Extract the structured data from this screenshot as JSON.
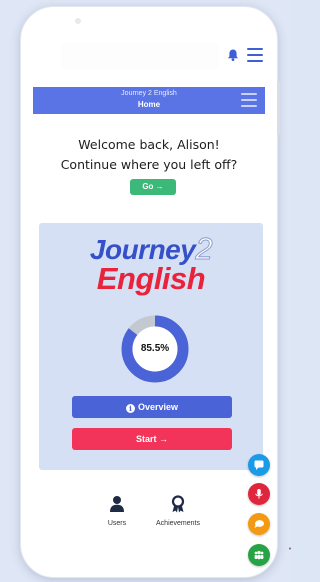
{
  "header": {
    "subtitle": "Journey 2 English",
    "title": "Home"
  },
  "welcome": {
    "line1": "Welcome back, Alison!",
    "line2": "Continue where you left off?",
    "go_label": "Go →"
  },
  "course_card": {
    "logo_part1": "Journey",
    "logo_number": "2",
    "logo_part2": "English",
    "progress_label": "85.5%",
    "progress_value": 0.855,
    "overview_label": "Overview",
    "start_label": "Start →"
  },
  "bottom_nav": {
    "users_label": "Users",
    "achievements_label": "Achievements"
  },
  "fabs": [
    {
      "icon": "chat-bubble-icon",
      "color": "#1a9be8"
    },
    {
      "icon": "microphone-icon",
      "color": "#e0263c"
    },
    {
      "icon": "speech-bubble-icon",
      "color": "#f39a12"
    },
    {
      "icon": "group-icon",
      "color": "#26a344"
    }
  ],
  "colors": {
    "accent_blue": "#5a74e6",
    "overview_blue": "#4a63d6",
    "start_red": "#f2335a",
    "go_green": "#3cb878",
    "card_bg": "#d6e0f5"
  }
}
